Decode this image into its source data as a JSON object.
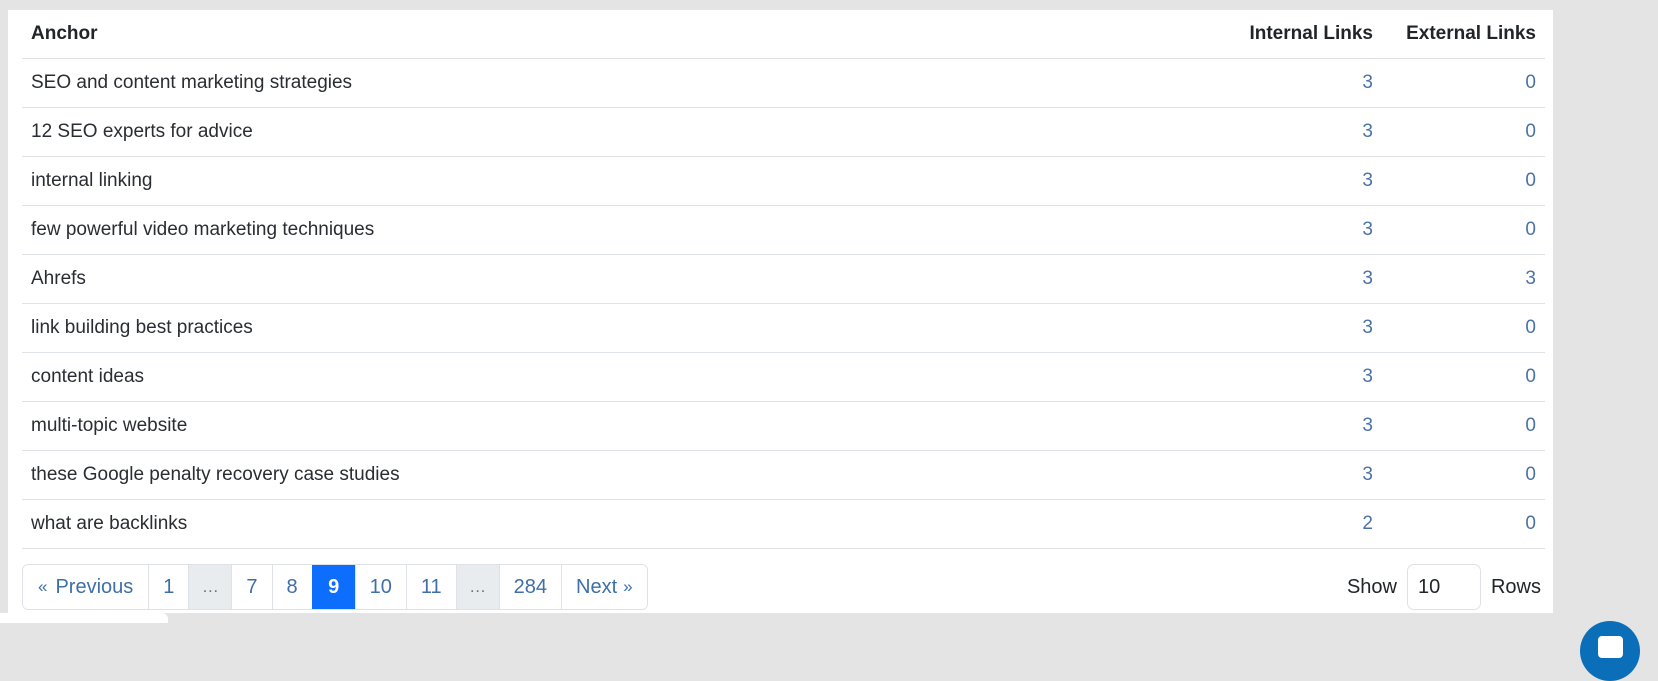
{
  "table": {
    "headers": {
      "anchor": "Anchor",
      "internal": "Internal Links",
      "external": "External Links"
    },
    "rows": [
      {
        "anchor": "SEO and content marketing strategies",
        "internal": "3",
        "external": "0"
      },
      {
        "anchor": "12 SEO experts for advice",
        "internal": "3",
        "external": "0"
      },
      {
        "anchor": "internal linking",
        "internal": "3",
        "external": "0"
      },
      {
        "anchor": "few powerful video marketing techniques",
        "internal": "3",
        "external": "0"
      },
      {
        "anchor": "Ahrefs",
        "internal": "3",
        "external": "3"
      },
      {
        "anchor": "link building best practices",
        "internal": "3",
        "external": "0"
      },
      {
        "anchor": "content ideas",
        "internal": "3",
        "external": "0"
      },
      {
        "anchor": "multi-topic website",
        "internal": "3",
        "external": "0"
      },
      {
        "anchor": "these Google penalty recovery case studies",
        "internal": "3",
        "external": "0"
      },
      {
        "anchor": "what are backlinks",
        "internal": "2",
        "external": "0"
      }
    ]
  },
  "pagination": {
    "previous_chevron": "«",
    "previous_label": "Previous",
    "next_label": "Next",
    "next_chevron": "»",
    "pages": [
      "1",
      "…",
      "7",
      "8",
      "9",
      "10",
      "11",
      "…",
      "284"
    ],
    "current": "9"
  },
  "rows_control": {
    "show_label": "Show",
    "value": "10",
    "rows_label": "Rows"
  },
  "colors": {
    "link": "#4a72a6",
    "active_page": "#0d6efd",
    "chat_bubble": "#0a6fb8"
  }
}
